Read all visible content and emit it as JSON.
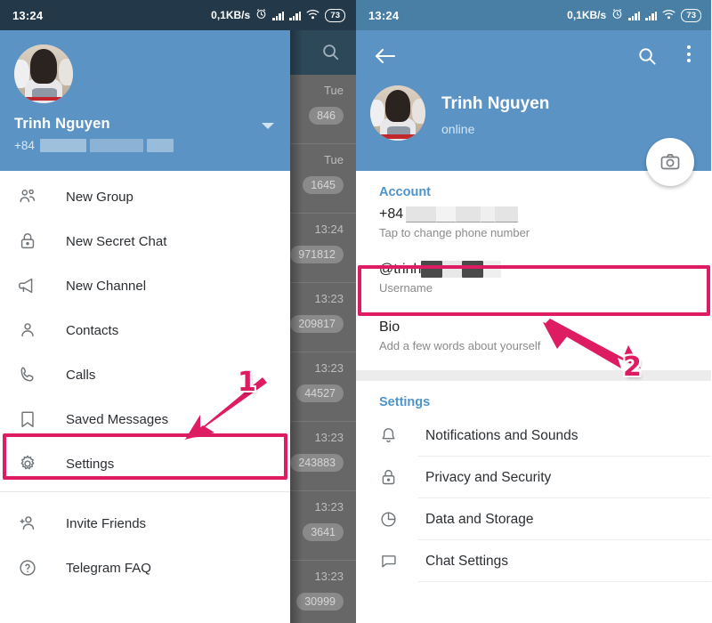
{
  "status_bar": {
    "time": "13:24",
    "network_speed": "0,1KB/s",
    "battery": "73",
    "alarm_icon": "alarm-icon",
    "signal_icon": "signal-bars-icon",
    "wifi_icon": "wifi-icon"
  },
  "left_panel": {
    "chat_list": {
      "search_icon": "search-icon",
      "rows": [
        {
          "time": "Tue",
          "badge": "846"
        },
        {
          "time": "Tue",
          "badge": "1645"
        },
        {
          "time": "13:24",
          "badge": "971812"
        },
        {
          "time": "13:23",
          "badge": "209817"
        },
        {
          "time": "13:23",
          "badge": "44527"
        },
        {
          "time": "13:23",
          "badge": "243883"
        },
        {
          "time": "13:23",
          "badge": "3641"
        },
        {
          "time": "13:23",
          "badge": "30999"
        }
      ]
    },
    "drawer": {
      "account_name": "Trinh Nguyen",
      "phone_prefix": "+84",
      "caret_icon": "chevron-down-icon",
      "avatar": "user-avatar",
      "menu": [
        {
          "label": "New Group",
          "icon": "group-icon"
        },
        {
          "label": "New Secret Chat",
          "icon": "lock-icon"
        },
        {
          "label": "New Channel",
          "icon": "megaphone-icon"
        },
        {
          "label": "Contacts",
          "icon": "person-icon"
        },
        {
          "label": "Calls",
          "icon": "phone-icon"
        },
        {
          "label": "Saved Messages",
          "icon": "bookmark-icon"
        },
        {
          "label": "Settings",
          "icon": "gear-icon"
        }
      ],
      "menu_bottom": [
        {
          "label": "Invite Friends",
          "icon": "person-add-icon"
        },
        {
          "label": "Telegram FAQ",
          "icon": "question-circle-icon"
        }
      ]
    }
  },
  "right_panel": {
    "header": {
      "back_icon": "back-arrow-icon",
      "search_icon": "search-icon",
      "more_icon": "overflow-menu-icon",
      "avatar": "user-avatar",
      "name": "Trinh Nguyen",
      "status": "online",
      "camera_fab_icon": "camera-icon"
    },
    "account": {
      "section_title": "Account",
      "phone_value": "+84",
      "phone_hint": "Tap to change phone number",
      "username_value": "@trinh",
      "username_hint": "Username",
      "bio_value": "Bio",
      "bio_hint": "Add a few words about yourself"
    },
    "settings": {
      "section_title": "Settings",
      "items": [
        {
          "label": "Notifications and Sounds",
          "icon": "bell-icon"
        },
        {
          "label": "Privacy and Security",
          "icon": "lock-icon"
        },
        {
          "label": "Data and Storage",
          "icon": "pie-chart-icon"
        },
        {
          "label": "Chat Settings",
          "icon": "chat-bubble-icon"
        }
      ]
    }
  },
  "annotations": {
    "step_one": "1",
    "step_two": "2",
    "highlight_color": "#dd1c62"
  }
}
